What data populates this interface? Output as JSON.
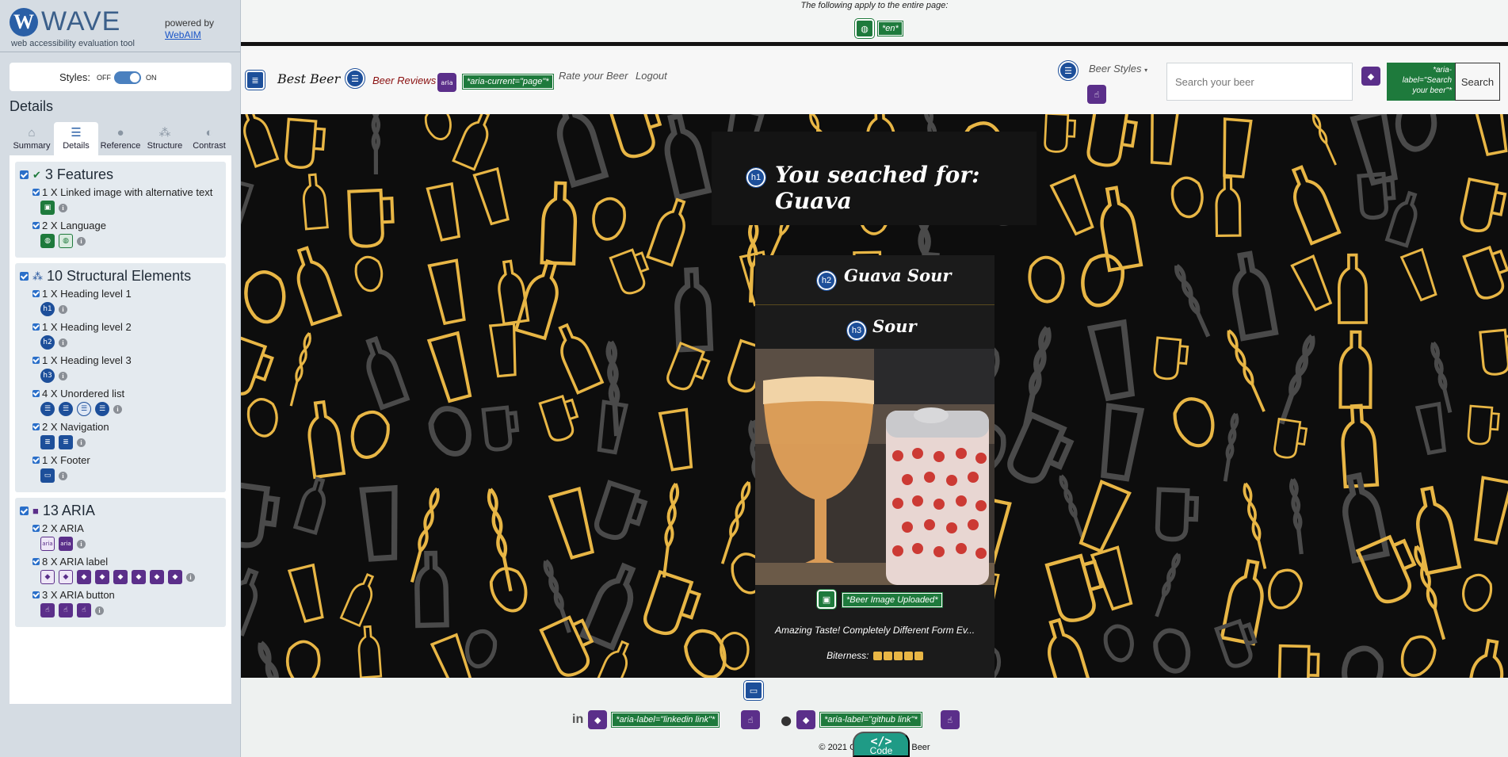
{
  "wave": {
    "logo_letter": "W",
    "wordmark": "WAVE",
    "subtitle": "web accessibility evaluation tool",
    "powered_by": "powered by",
    "webaim_link": "WebAIM",
    "styles_label": "Styles:",
    "styles_off": "OFF",
    "styles_on": "ON",
    "styles_enabled": true,
    "details_title": "Details",
    "tabs": [
      {
        "label": "Summary",
        "icon": "home-icon",
        "active": false
      },
      {
        "label": "Details",
        "icon": "list-icon",
        "active": true
      },
      {
        "label": "Reference",
        "icon": "info-icon",
        "active": false
      },
      {
        "label": "Structure",
        "icon": "hierarchy-icon",
        "active": false
      },
      {
        "label": "Contrast",
        "icon": "contrast-icon",
        "active": false
      }
    ],
    "groups": [
      {
        "title": "3 Features",
        "icon": "check-circle-icon",
        "items": [
          {
            "label": "1 X Linked image with alternative text"
          },
          {
            "label": "2 X Language"
          }
        ]
      },
      {
        "title": "10 Structural Elements",
        "icon": "sitemap-icon",
        "items": [
          {
            "label": "1 X Heading level 1",
            "badge": "h1"
          },
          {
            "label": "1 X Heading level 2",
            "badge": "h2"
          },
          {
            "label": "1 X Heading level 3",
            "badge": "h3"
          },
          {
            "label": "4 X Unordered list"
          },
          {
            "label": "2 X Navigation"
          },
          {
            "label": "1 X Footer"
          }
        ]
      },
      {
        "title": "13 ARIA",
        "icon": "aria-cube-icon",
        "items": [
          {
            "label": "2 X ARIA",
            "badge": "aria"
          },
          {
            "label": "8 X ARIA label"
          },
          {
            "label": "3 X ARIA button"
          }
        ]
      }
    ]
  },
  "page": {
    "top_note": "The following apply to the entire page:",
    "lang_tag": "*en*",
    "brand": "Best Beer",
    "nav": {
      "reviews": "Beer Reviews",
      "aria_badge": "aria",
      "aria_current": "*aria-current=\"page\"*",
      "rate": "Rate your Beer",
      "logout": "Logout",
      "styles": "Beer Styles"
    },
    "search": {
      "placeholder": "Search your beer",
      "aria_label": "*aria-label=\"Search your beer\"*",
      "button": "Search"
    },
    "h1_badge": "h1",
    "h1": "You seached for: Guava",
    "card": {
      "h2_badge": "h2",
      "h2": "Guava Sour",
      "h3_badge": "h3",
      "h3": "Sour",
      "image_label": "*Beer Image Uploaded*",
      "description": "Amazing Taste! Completely Different Form Ev...",
      "bitterness_label": "Biterness:",
      "bitterness_level": 5
    },
    "footer": {
      "linkedin_label": "*aria-label=\"linkedin link\"*",
      "github_label": "*aria-label=\"github link\"*",
      "copyright": "© 2021 Copyright: Best Beer",
      "code_button": "Code",
      "code_glyph": "</>"
    }
  },
  "colors": {
    "wave_sidebar": "#d5dce3",
    "feature_green": "#1e7a3c",
    "structure_blue": "#1d4f9a",
    "aria_purple": "#5b2f8a",
    "reviews_red": "#8a1010",
    "pattern_gold": "#e8b645",
    "code_teal": "#1f9b86"
  }
}
